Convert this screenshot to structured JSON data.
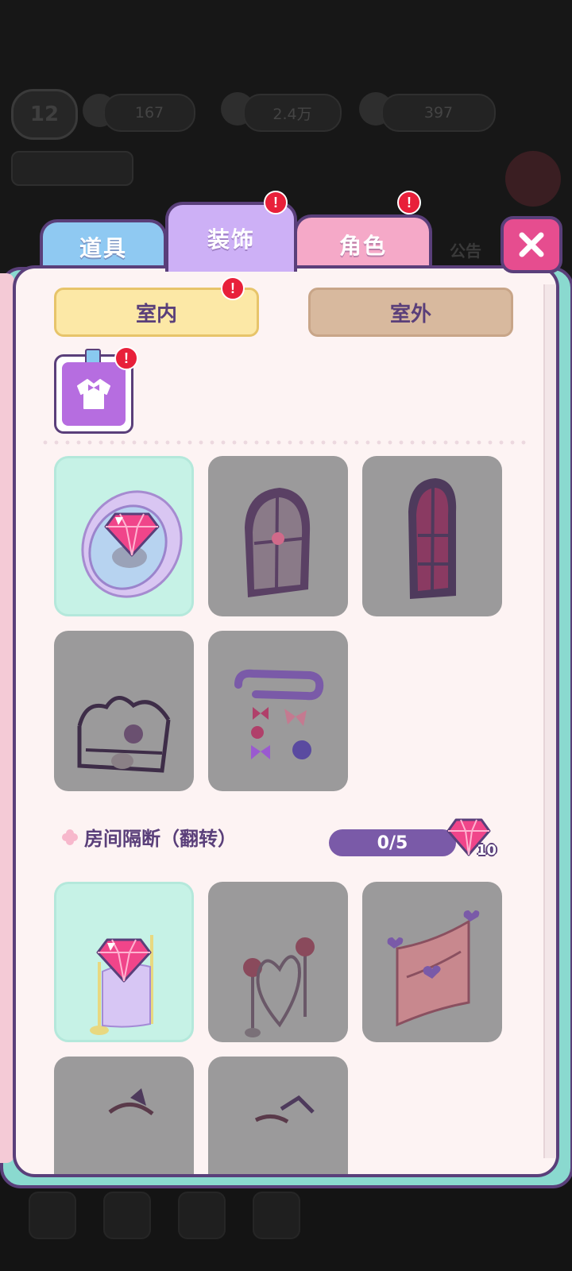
{
  "hud": {
    "level": "12",
    "energy": "167",
    "coins": "2.4万",
    "gems": "397",
    "notice": "公告"
  },
  "tabs": [
    {
      "label": "道具"
    },
    {
      "label": "装饰"
    },
    {
      "label": "角色"
    }
  ],
  "subtabs": {
    "indoor": "室内",
    "outdoor": "室外"
  },
  "alert_mark": "!",
  "section": {
    "title": "房间隔断（翻转）",
    "progress": "0/5",
    "cost": "10"
  },
  "colors": {
    "accent_purple": "#5a3f7a",
    "owned_tile": "#c6f2e6",
    "locked_tile": "#9b9a9b",
    "alert_red": "#e8203a",
    "gem_pink": "#f0458a"
  },
  "icons": {
    "close": "close-icon",
    "gem": "gem-icon",
    "category": "outfit-icon"
  }
}
